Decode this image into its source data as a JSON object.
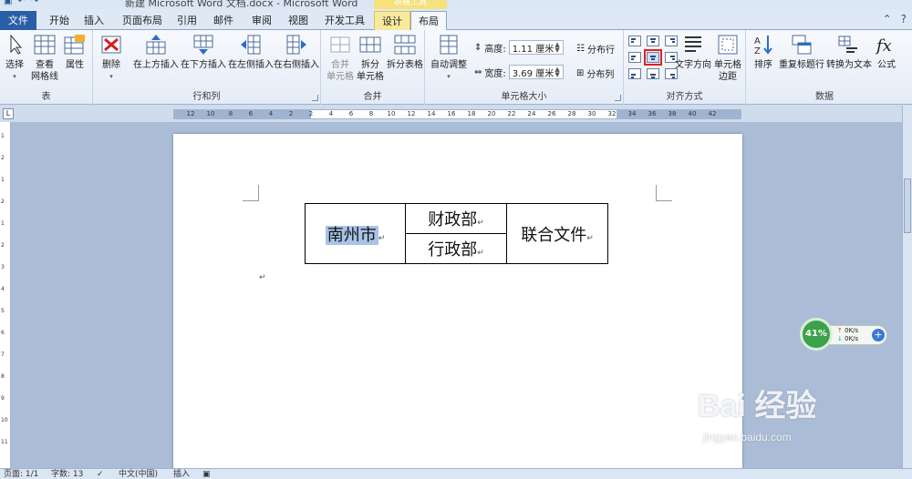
{
  "window": {
    "title": "新建 Microsoft Word 文档.docx - Microsoft Word",
    "context_group": "表格工具"
  },
  "tabs": [
    "文件",
    "开始",
    "插入",
    "页面布局",
    "引用",
    "邮件",
    "审阅",
    "视图",
    "开发工具",
    "设计",
    "布局"
  ],
  "active_tab": "布局",
  "ribbon": {
    "table_group": {
      "label": "表",
      "select": "选择",
      "gridlines_1": "查看",
      "gridlines_2": "网格线",
      "properties": "属性"
    },
    "rows_cols_group": {
      "label": "行和列",
      "delete": "删除",
      "insert_above": "在上方插入",
      "insert_below": "在下方插入",
      "insert_left": "在左侧插入",
      "insert_right": "在右侧插入"
    },
    "merge_group": {
      "label": "合并",
      "merge_1": "合并",
      "merge_2": "单元格",
      "split_cells_1": "拆分",
      "split_cells_2": "单元格",
      "split_table": "拆分表格"
    },
    "cell_size_group": {
      "label": "单元格大小",
      "autofit": "自动调整",
      "height_label": "高度:",
      "height_value": "1.11 厘米",
      "width_label": "宽度:",
      "width_value": "3.69 厘米",
      "distribute_rows": "分布行",
      "distribute_cols": "分布列"
    },
    "alignment_group": {
      "label": "对齐方式",
      "text_direction": "文字方向",
      "cell_margins_1": "单元格",
      "cell_margins_2": "边距"
    },
    "data_group": {
      "label": "数据",
      "sort": "排序",
      "repeat_header": "重复标题行",
      "convert_text": "转换为文本",
      "formula": "公式"
    }
  },
  "ruler": {
    "ticks": [
      "12",
      "10",
      "8",
      "6",
      "4",
      "2",
      "2",
      "4",
      "6",
      "8",
      "10",
      "12",
      "14",
      "16",
      "18",
      "20",
      "22",
      "24",
      "26",
      "28",
      "30",
      "32",
      "34",
      "36",
      "38",
      "40",
      "42"
    ],
    "corner": "L",
    "vticks": [
      "1",
      "2",
      "1",
      "2",
      "1",
      "2",
      "3",
      "4",
      "5",
      "6",
      "7",
      "8",
      "9",
      "10",
      "11"
    ]
  },
  "document": {
    "cell_left": "南州市",
    "cell_mid_top": "财政部",
    "cell_mid_bottom": "行政部",
    "cell_right": "联合文件",
    "para_mark": "↵"
  },
  "speed_widget": {
    "percent": "41%",
    "up": "0K/s",
    "down": "0K/s"
  },
  "watermark": {
    "brand": "Bai  经验",
    "url": "jingyan.baidu.com"
  },
  "statusbar": {
    "page": "页面: 1/1",
    "words": "字数: 13",
    "language": "中文(中国)",
    "mode": "插入"
  }
}
